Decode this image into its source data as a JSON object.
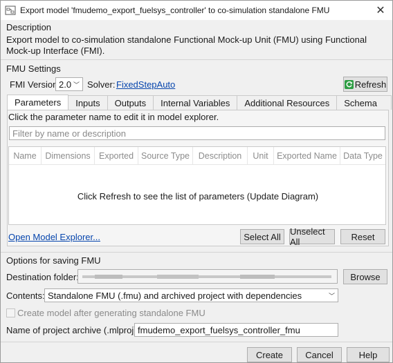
{
  "window": {
    "title": "Export model 'fmudemo_export_fuelsys_controller' to co-simulation standalone FMU",
    "close_glyph": "✕"
  },
  "description": {
    "heading": "Description",
    "text": "Export model to co-simulation standalone Functional Mock-up Unit (FMU) using Functional Mock-up Interface (FMI)."
  },
  "fmu_settings": {
    "heading": "FMU Settings",
    "fmi_version_label": "FMI Version",
    "fmi_version_value": "2.0",
    "solver_label": "Solver:",
    "solver_link": "FixedStepAuto",
    "refresh_label": "Refresh"
  },
  "tabs": [
    {
      "label": "Parameters",
      "active": true
    },
    {
      "label": "Inputs"
    },
    {
      "label": "Outputs"
    },
    {
      "label": "Internal Variables"
    },
    {
      "label": "Additional Resources"
    },
    {
      "label": "Schema"
    }
  ],
  "parameters": {
    "hint": "Click the parameter name to edit it in model explorer.",
    "filter_placeholder": "Filter by name or description",
    "columns": [
      "Name",
      "Dimensions",
      "Exported",
      "Source Type",
      "Description",
      "Unit",
      "Exported Name",
      "Data Type"
    ],
    "empty_message": "Click Refresh to see the list of parameters (Update Diagram)",
    "open_explorer_link": "Open Model Explorer...",
    "select_all": "Select All",
    "unselect_all": "Unselect All",
    "reset": "Reset"
  },
  "saving": {
    "heading": "Options for saving FMU",
    "destination_label": "Destination folder:",
    "browse_label": "Browse",
    "contents_label": "Contents:",
    "contents_value": "Standalone FMU (.fmu) and archived project with dependencies",
    "create_model_label": "Create model after generating standalone FMU",
    "create_model_checked": false,
    "archive_label": "Name of project archive (.mlproj):",
    "archive_value": "fmudemo_export_fuelsys_controller_fmu"
  },
  "footer": {
    "create": "Create",
    "cancel": "Cancel",
    "help": "Help"
  },
  "colors": {
    "link": "#0645ad",
    "refresh_icon": "#2e9e44"
  }
}
